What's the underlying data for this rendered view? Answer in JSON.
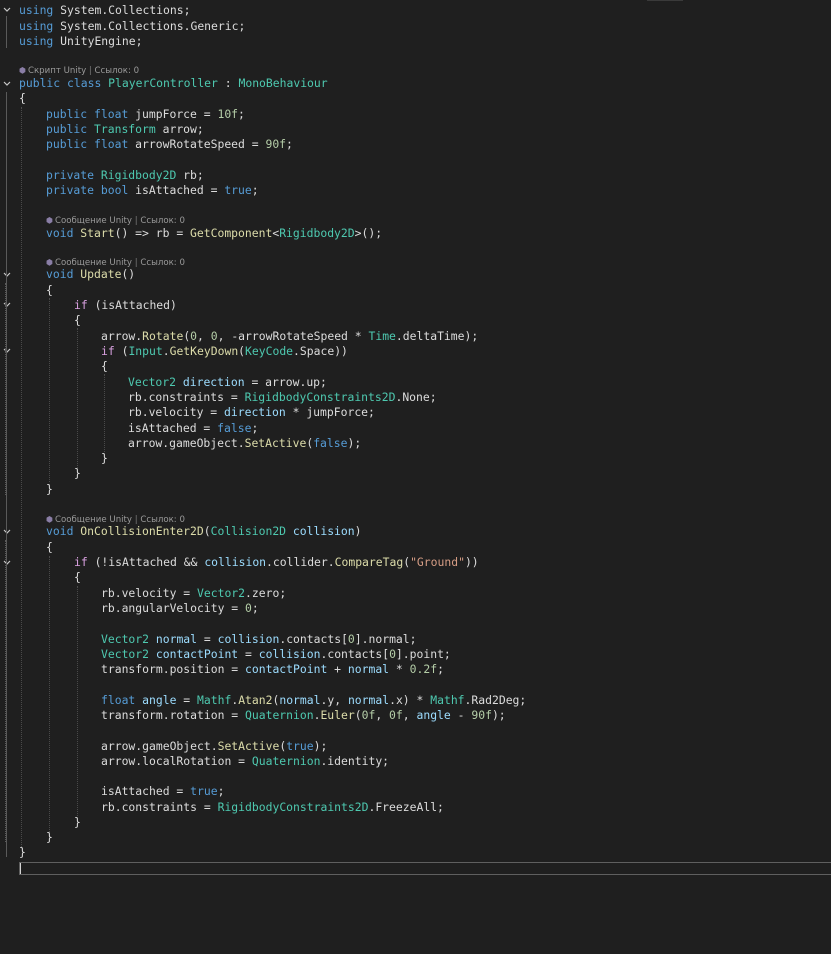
{
  "editor": {
    "lines": {
      "l1": [
        [
          "using",
          "kw"
        ],
        " ",
        [
          "System",
          "ns"
        ],
        ".",
        [
          "Collections",
          "ns"
        ],
        ";"
      ],
      "l2": [
        [
          "using",
          "kw"
        ],
        " ",
        [
          "System",
          "ns"
        ],
        ".",
        [
          "Collections",
          "ns"
        ],
        ".",
        [
          "Generic",
          "ns"
        ],
        ";"
      ],
      "l3": [
        [
          "using",
          "kw"
        ],
        " ",
        [
          "UnityEngine",
          "ns"
        ],
        ";"
      ],
      "l5": [
        [
          "public",
          "kw"
        ],
        " ",
        [
          "class",
          "kw"
        ],
        " ",
        [
          "PlayerController",
          "type"
        ],
        " : ",
        [
          "MonoBehaviour",
          "type"
        ]
      ],
      "l6": [
        "{"
      ],
      "l7": [
        [
          "public",
          "kw"
        ],
        " ",
        [
          "float",
          "kw"
        ],
        " jumpForce = ",
        [
          "10f",
          "num"
        ],
        ";"
      ],
      "l8": [
        [
          "public",
          "kw"
        ],
        " ",
        [
          "Transform",
          "type"
        ],
        " arrow;"
      ],
      "l9": [
        [
          "public",
          "kw"
        ],
        " ",
        [
          "float",
          "kw"
        ],
        " arrowRotateSpeed = ",
        [
          "90f",
          "num"
        ],
        ";"
      ],
      "l11": [
        [
          "private",
          "kw"
        ],
        " ",
        [
          "Rigidbody2D",
          "type"
        ],
        " rb;"
      ],
      "l12": [
        [
          "private",
          "kw"
        ],
        " ",
        [
          "bool",
          "kw"
        ],
        " isAttached = ",
        [
          "true",
          "kw"
        ],
        ";"
      ],
      "l14": [
        [
          "void",
          "kw"
        ],
        " ",
        [
          "Start",
          "fn"
        ],
        "() => rb = ",
        [
          "GetComponent",
          "fn"
        ],
        "<",
        [
          "Rigidbody2D",
          "type"
        ],
        ">();"
      ],
      "l16": [
        [
          "void",
          "kw"
        ],
        " ",
        [
          "Update",
          "fn"
        ],
        "()"
      ],
      "l17": [
        "{"
      ],
      "l18": [
        [
          "if",
          "ctl"
        ],
        " (isAttached)"
      ],
      "l19": [
        "{"
      ],
      "l20": [
        "arrow.",
        [
          "Rotate",
          "fn"
        ],
        "(",
        [
          "0",
          "num"
        ],
        ", ",
        [
          "0",
          "num"
        ],
        ", -arrowRotateSpeed * ",
        [
          "Time",
          "type"
        ],
        ".deltaTime);"
      ],
      "l21": [
        [
          "if",
          "ctl"
        ],
        " (",
        [
          "Input",
          "type"
        ],
        ".",
        [
          "GetKeyDown",
          "fn"
        ],
        "(",
        [
          "KeyCode",
          "type"
        ],
        ".Space))"
      ],
      "l22": [
        "{"
      ],
      "l23": [
        [
          "Vector2",
          "type"
        ],
        " ",
        [
          "direction",
          "var"
        ],
        " = arrow.up;"
      ],
      "l24": [
        "rb.constraints = ",
        [
          "RigidbodyConstraints2D",
          "type"
        ],
        ".None;"
      ],
      "l25": [
        "rb.velocity = ",
        [
          "direction",
          "var"
        ],
        " * jumpForce;"
      ],
      "l26": [
        "isAttached = ",
        [
          "false",
          "kw"
        ],
        ";"
      ],
      "l27": [
        "arrow.gameObject.",
        [
          "SetActive",
          "fn"
        ],
        "(",
        [
          "false",
          "kw"
        ],
        ");"
      ],
      "l28": [
        "}"
      ],
      "l29": [
        "}"
      ],
      "l30": [
        "}"
      ],
      "l32": [
        [
          "void",
          "kw"
        ],
        " ",
        [
          "OnCollisionEnter2D",
          "fn"
        ],
        "(",
        [
          "Collision2D",
          "type"
        ],
        " ",
        [
          "collision",
          "var"
        ],
        ")"
      ],
      "l33": [
        "{"
      ],
      "l34": [
        [
          "if",
          "ctl"
        ],
        " (!isAttached && ",
        [
          "collision",
          "var"
        ],
        ".collider.",
        [
          "CompareTag",
          "fn"
        ],
        "(",
        [
          "\"Ground\"",
          "str"
        ],
        "))"
      ],
      "l35": [
        "{"
      ],
      "l36": [
        "rb.velocity = ",
        [
          "Vector2",
          "type"
        ],
        ".zero;"
      ],
      "l37": [
        "rb.angularVelocity = ",
        [
          "0",
          "num"
        ],
        ";"
      ],
      "l39": [
        [
          "Vector2",
          "type"
        ],
        " ",
        [
          "normal",
          "var"
        ],
        " = ",
        [
          "collision",
          "var"
        ],
        ".contacts[",
        [
          "0",
          "num"
        ],
        "].normal;"
      ],
      "l40": [
        [
          "Vector2",
          "type"
        ],
        " ",
        [
          "contactPoint",
          "var"
        ],
        " = ",
        [
          "collision",
          "var"
        ],
        ".contacts[",
        [
          "0",
          "num"
        ],
        "].point;"
      ],
      "l41": [
        "transform.position = ",
        [
          "contactPoint",
          "var"
        ],
        " + ",
        [
          "normal",
          "var"
        ],
        " * ",
        [
          "0.2f",
          "num"
        ],
        ";"
      ],
      "l43": [
        [
          "float",
          "kw"
        ],
        " ",
        [
          "angle",
          "var"
        ],
        " = ",
        [
          "Mathf",
          "type"
        ],
        ".",
        [
          "Atan2",
          "fn"
        ],
        "(",
        [
          "normal",
          "var"
        ],
        ".y, ",
        [
          "normal",
          "var"
        ],
        ".x) * ",
        [
          "Mathf",
          "type"
        ],
        ".Rad2Deg;"
      ],
      "l44": [
        "transform.rotation = ",
        [
          "Quaternion",
          "type"
        ],
        ".",
        [
          "Euler",
          "fn"
        ],
        "(",
        [
          "0f",
          "num"
        ],
        ", ",
        [
          "0f",
          "num"
        ],
        ", ",
        [
          "angle",
          "var"
        ],
        " - ",
        [
          "90f",
          "num"
        ],
        ");"
      ],
      "l46": [
        "arrow.gameObject.",
        [
          "SetActive",
          "fn"
        ],
        "(",
        [
          "true",
          "kw"
        ],
        ");"
      ],
      "l47": [
        "arrow.localRotation = ",
        [
          "Quaternion",
          "type"
        ],
        ".identity;"
      ],
      "l49": [
        "isAttached = ",
        [
          "true",
          "kw"
        ],
        ";"
      ],
      "l50": [
        "rb.constraints = ",
        [
          "RigidbodyConstraints2D",
          "type"
        ],
        ".FreezeAll;"
      ],
      "l51": [
        "}"
      ],
      "l52": [
        "}"
      ],
      "l53": [
        "}"
      ]
    },
    "codelens": {
      "class_lens": {
        "kind": "Скрипт Unity",
        "refs": "Ссылок: 0"
      },
      "start_lens": {
        "kind": "Сообщение Unity",
        "refs": "Ссылок: 0"
      },
      "update_lens": {
        "kind": "Сообщение Unity",
        "refs": "Ссылок: 0"
      },
      "collision_lens": {
        "kind": "Сообщение Unity",
        "refs": "Ссылок: 0"
      },
      "separator": "|",
      "icon": "unity-icon"
    }
  },
  "colors": {
    "background": "#1f1f1f",
    "keyword": "#569cd6",
    "control": "#d8a0df",
    "type": "#4ec9b0",
    "method": "#dcdcaa",
    "number": "#b5cea8",
    "string": "#d69d85",
    "variable": "#9cdcfe"
  }
}
